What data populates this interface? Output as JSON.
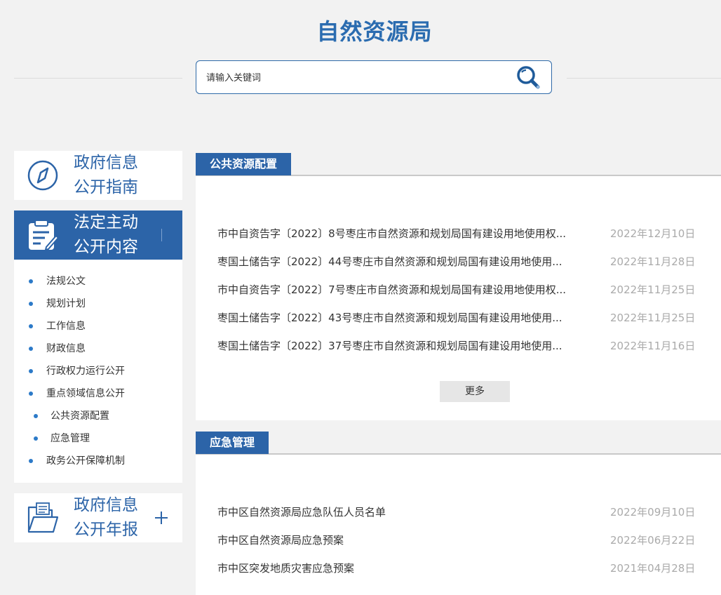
{
  "header": {
    "title": "自然资源局",
    "search_placeholder": "请输入关键词",
    "search_value": ""
  },
  "sidebar": {
    "guide": {
      "line1": "政府信息",
      "line2": "公开指南",
      "icon": "compass-icon"
    },
    "legal": {
      "line1": "法定主动",
      "line2": "公开内容",
      "icon": "clipboard-icon"
    },
    "items": [
      {
        "label": "法规公文",
        "sub": false
      },
      {
        "label": "规划计划",
        "sub": false
      },
      {
        "label": "工作信息",
        "sub": false
      },
      {
        "label": "财政信息",
        "sub": false
      },
      {
        "label": "行政权力运行公开",
        "sub": false
      },
      {
        "label": "重点领域信息公开",
        "sub": false
      },
      {
        "label": "公共资源配置",
        "sub": true
      },
      {
        "label": "应急管理",
        "sub": true
      },
      {
        "label": "政务公开保障机制",
        "sub": false
      }
    ],
    "annual": {
      "line1": "政府信息",
      "line2": "公开年报",
      "icon": "folder-icon",
      "expand_icon": "plus-icon"
    }
  },
  "public_resources": {
    "tab": "公共资源配置",
    "rows": [
      {
        "title": "市中自资告字〔2022〕8号枣庄市自然资源和规划局国有建设用地使用权...",
        "date": "2022年12月10日"
      },
      {
        "title": "枣国土储告字〔2022〕44号枣庄市自然资源和规划局国有建设用地使用...",
        "date": "2022年11月28日"
      },
      {
        "title": "市中自资告字〔2022〕7号枣庄市自然资源和规划局国有建设用地使用权...",
        "date": "2022年11月25日"
      },
      {
        "title": "枣国土储告字〔2022〕43号枣庄市自然资源和规划局国有建设用地使用...",
        "date": "2022年11月25日"
      },
      {
        "title": "枣国土储告字〔2022〕37号枣庄市自然资源和规划局国有建设用地使用...",
        "date": "2022年11月16日"
      }
    ],
    "more": "更多"
  },
  "emergency": {
    "tab": "应急管理",
    "rows": [
      {
        "title": "市中区自然资源局应急队伍人员名单",
        "date": "2022年09月10日"
      },
      {
        "title": "市中区自然资源局应急预案",
        "date": "2022年06月22日"
      },
      {
        "title": "市中区突发地质灾害应急预案",
        "date": "2021年04月28日"
      }
    ]
  },
  "colors": {
    "brand": "#2c64a8",
    "background": "#f2f2f2",
    "date": "#aaaaaa"
  }
}
